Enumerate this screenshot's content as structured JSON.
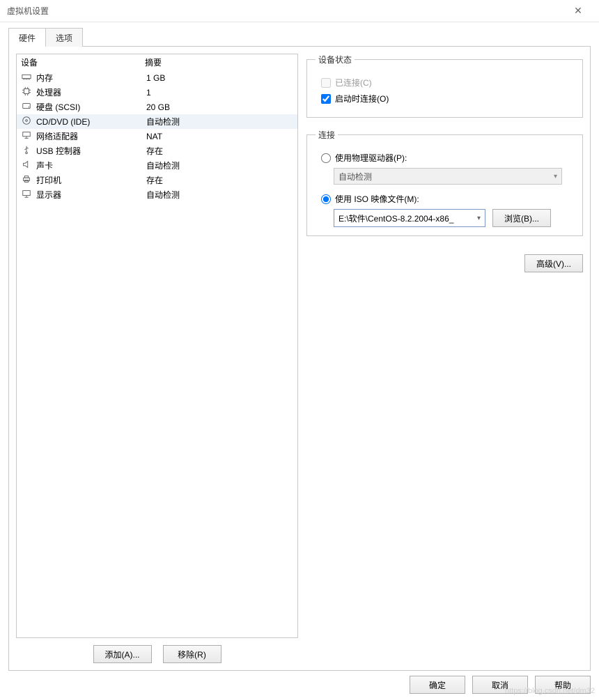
{
  "window": {
    "title": "虚拟机设置"
  },
  "tabs": {
    "hardware": "硬件",
    "options": "选项"
  },
  "table": {
    "header_device": "设备",
    "header_summary": "摘要",
    "rows": [
      {
        "icon": "memory",
        "name": "内存",
        "summary": "1 GB",
        "selected": false
      },
      {
        "icon": "cpu",
        "name": "处理器",
        "summary": "1",
        "selected": false
      },
      {
        "icon": "disk",
        "name": "硬盘 (SCSI)",
        "summary": "20 GB",
        "selected": false
      },
      {
        "icon": "cd",
        "name": "CD/DVD (IDE)",
        "summary": "自动检测",
        "selected": true
      },
      {
        "icon": "network",
        "name": "网络适配器",
        "summary": "NAT",
        "selected": false
      },
      {
        "icon": "usb",
        "name": "USB 控制器",
        "summary": "存在",
        "selected": false
      },
      {
        "icon": "sound",
        "name": "声卡",
        "summary": "自动检测",
        "selected": false
      },
      {
        "icon": "printer",
        "name": "打印机",
        "summary": "存在",
        "selected": false
      },
      {
        "icon": "display",
        "name": "显示器",
        "summary": "自动检测",
        "selected": false
      }
    ]
  },
  "left_buttons": {
    "add": "添加(A)...",
    "remove": "移除(R)"
  },
  "device_state": {
    "legend": "设备状态",
    "connected": "已连接(C)",
    "connected_checked": false,
    "connected_enabled": false,
    "connect_at_power": "启动时连接(O)",
    "connect_at_power_checked": true
  },
  "connection": {
    "legend": "连接",
    "physical": "使用物理驱动器(P):",
    "physical_value": "自动检测",
    "iso": "使用 ISO 映像文件(M):",
    "iso_value": "E:\\软件\\CentOS-8.2.2004-x86_",
    "browse": "浏览(B)...",
    "selected": "iso"
  },
  "advanced": "高级(V)...",
  "footer": {
    "ok": "确定",
    "cancel": "取消",
    "help": "帮助"
  },
  "watermark": "https://blog.csdn.net/dm32"
}
